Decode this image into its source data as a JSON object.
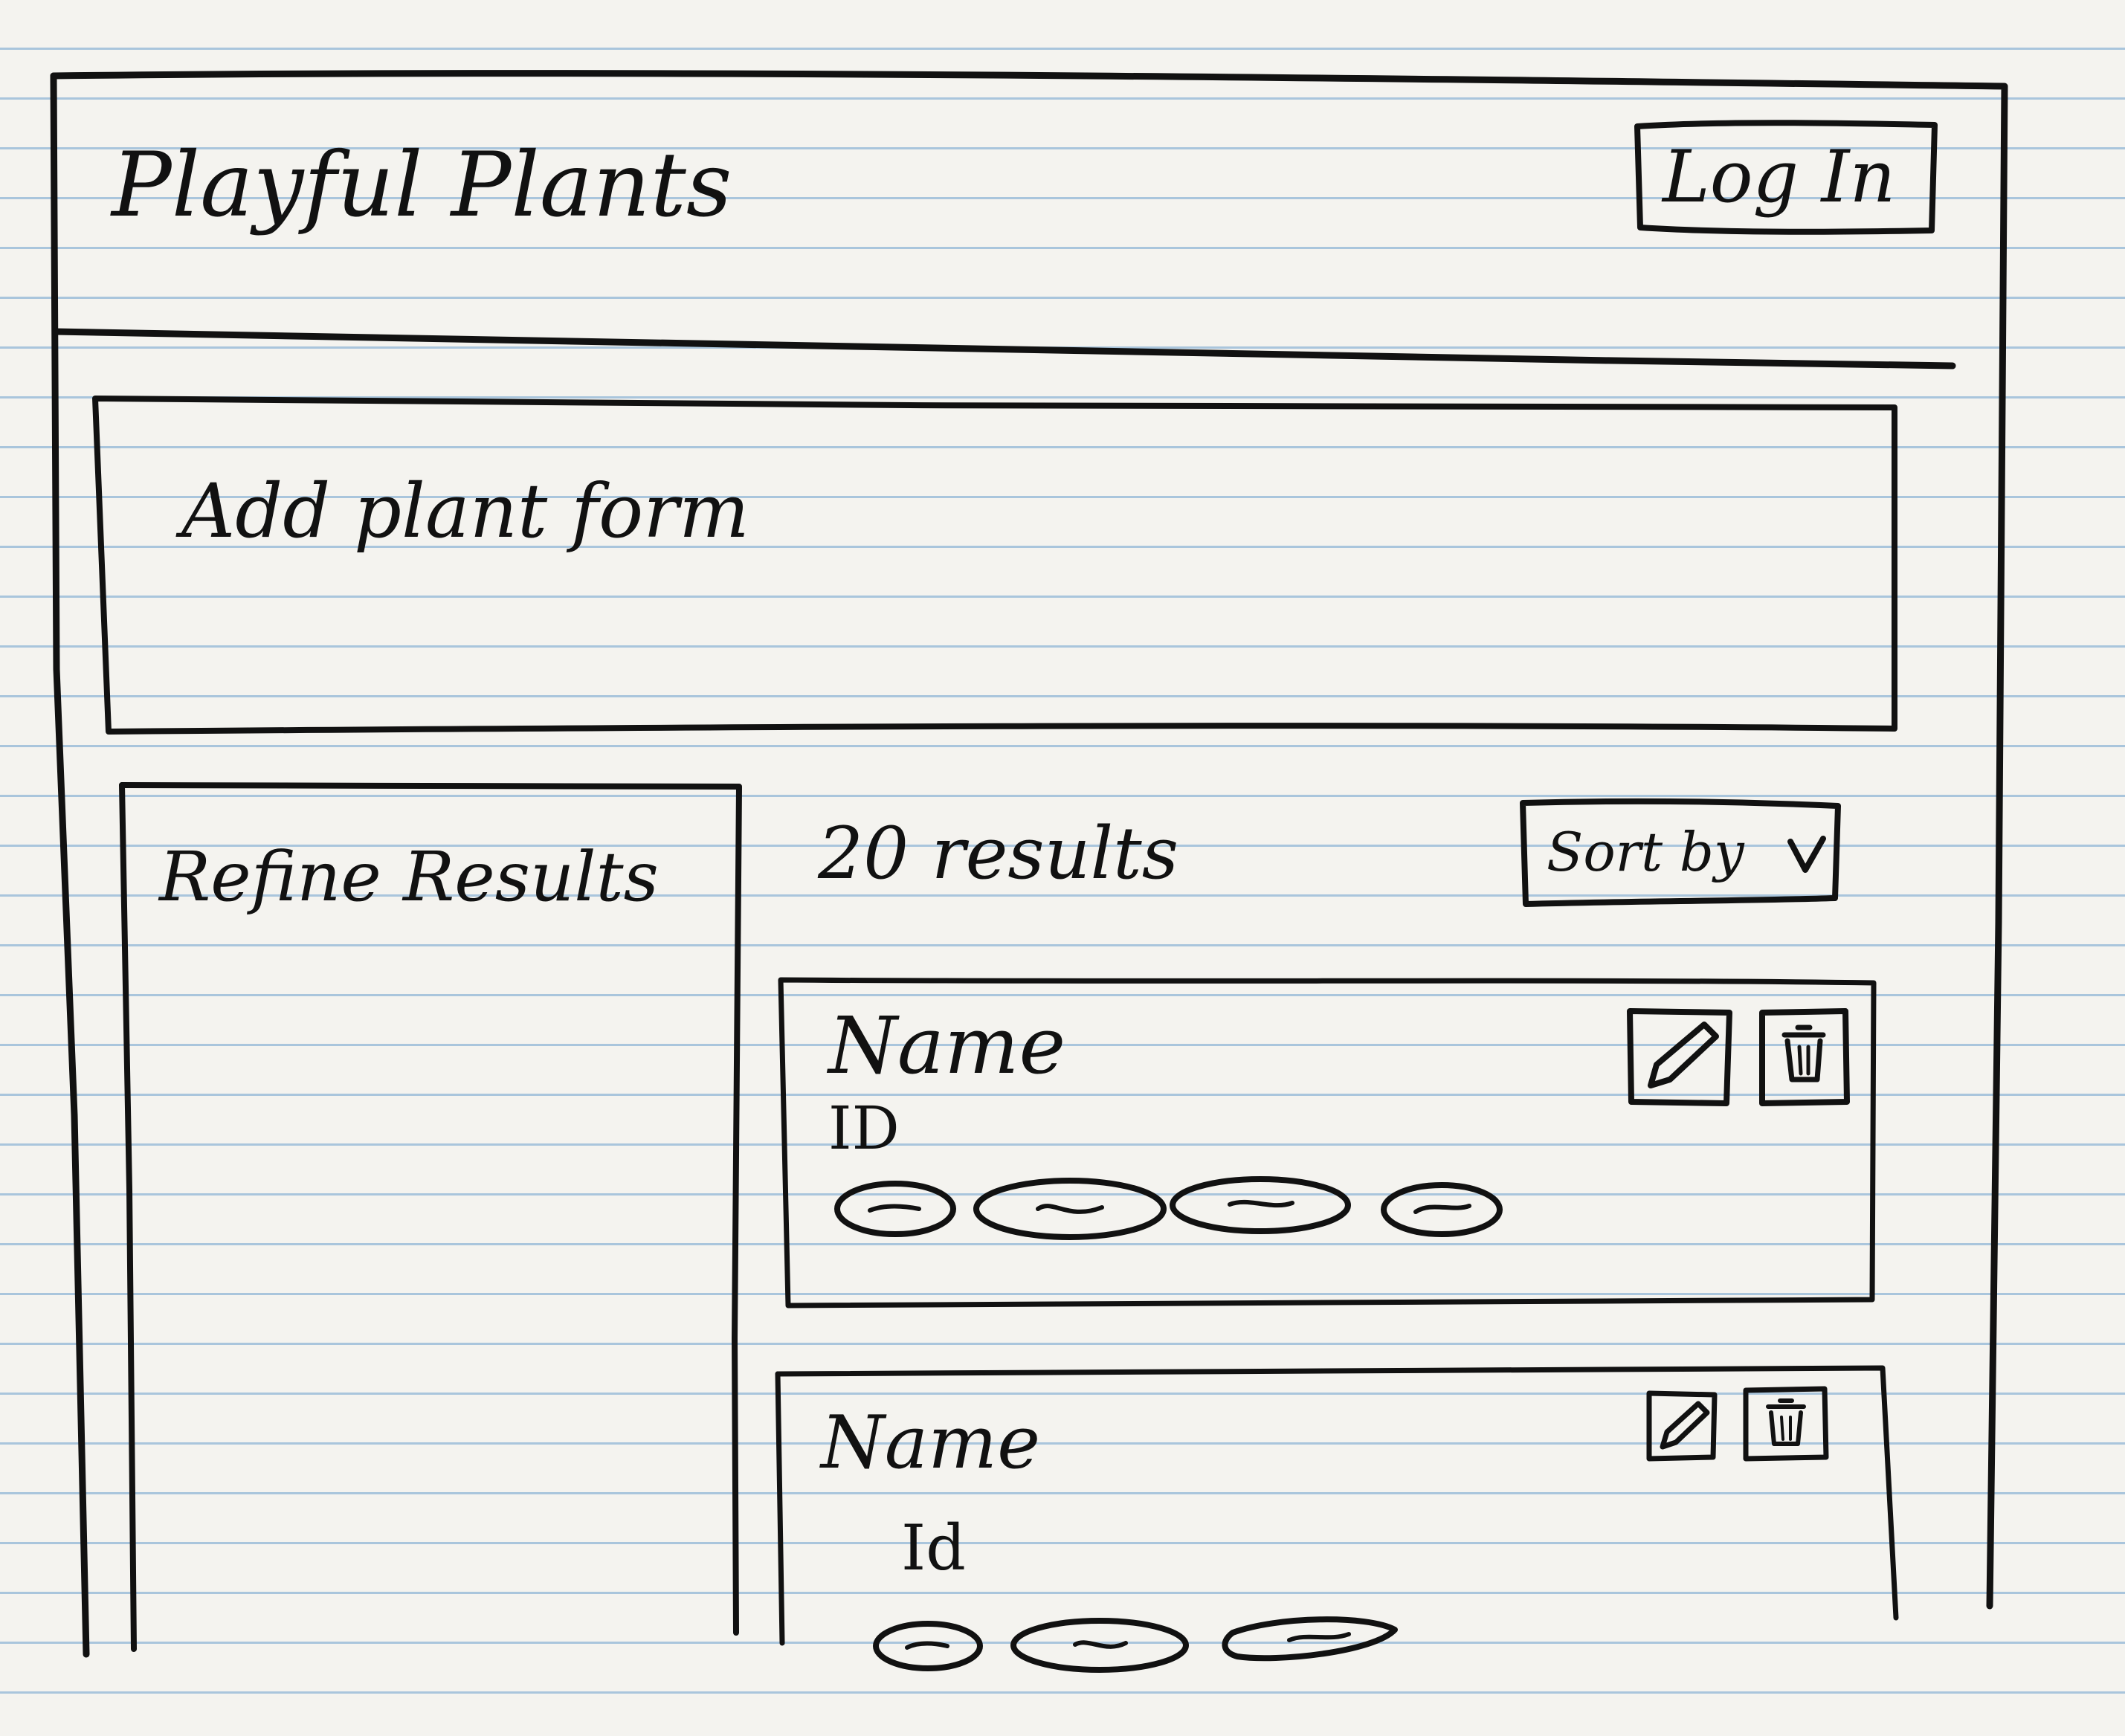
{
  "header": {
    "app_title": "Playful Plants",
    "login_label": "Log In"
  },
  "add_form": {
    "label": "Add plant form"
  },
  "sidebar": {
    "title": "Refine Results"
  },
  "results": {
    "count_label": "20 results",
    "sort_label": "Sort by",
    "sort_icon": "chevron-down-icon",
    "cards": [
      {
        "name": "Name",
        "id_label": "ID",
        "tag_count": 4,
        "edit_icon": "pencil-icon",
        "delete_icon": "trash-icon"
      },
      {
        "name": "Name",
        "id_label": "Id",
        "tag_count": 3,
        "edit_icon": "pencil-icon",
        "delete_icon": "trash-icon"
      }
    ]
  },
  "colors": {
    "paper": "#f4f3ef",
    "rule_line": "#a9c5dc",
    "ink": "#111111"
  }
}
